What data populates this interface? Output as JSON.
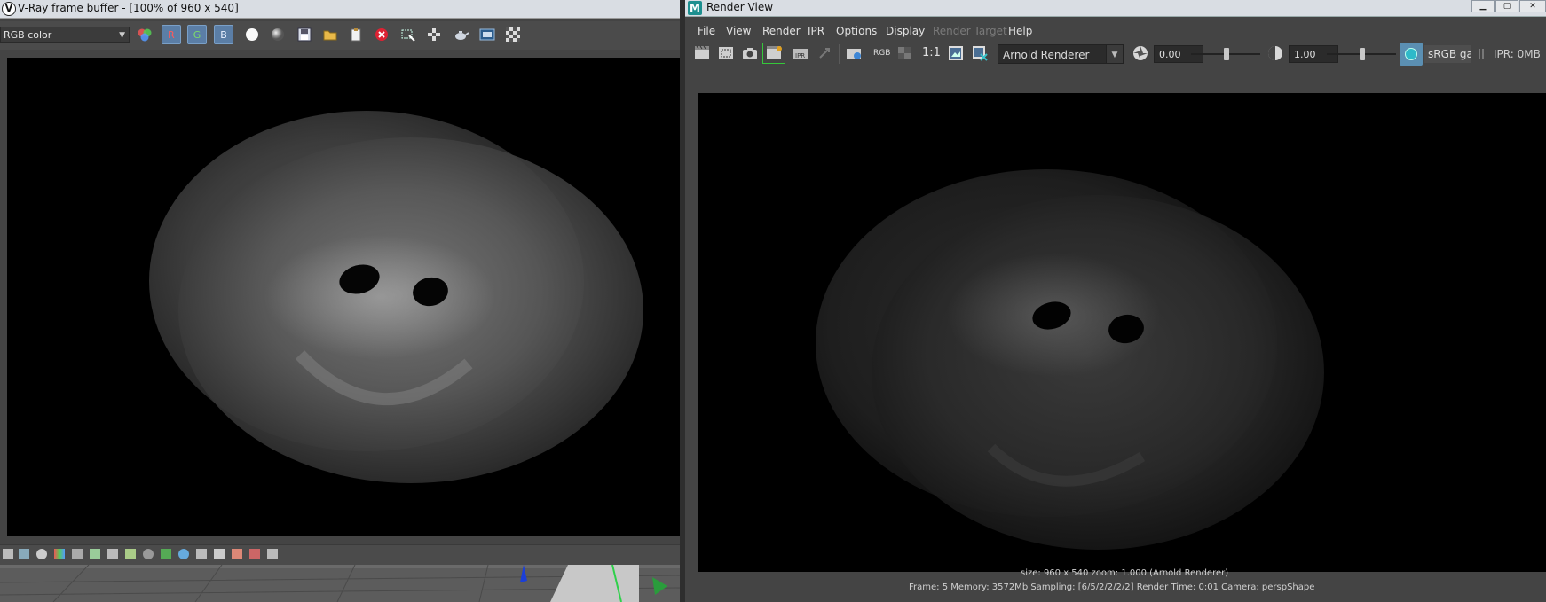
{
  "vray": {
    "title": "V-Ray frame buffer - [100% of 960 x 540]",
    "logo_letter": "V",
    "channel_select": "RGB color",
    "channel_buttons": [
      "R",
      "G",
      "B"
    ],
    "icons": [
      "color-channels-icon",
      "white-circle-icon",
      "grey-circle-icon",
      "save-icon",
      "open-folder-icon",
      "clipboard-icon",
      "clear-image-icon",
      "region-render-icon",
      "track-mouse-icon",
      "teapot-render-icon",
      "history-icon",
      "checker-icon"
    ]
  },
  "rv": {
    "title": "Render View",
    "logo_letter": "M",
    "menus": [
      "File",
      "View",
      "Render",
      "IPR",
      "Options",
      "Display",
      "Render Target",
      "Help"
    ],
    "ratio_label": "1:1",
    "rgb_label": "RGB",
    "renderer_select": "Arnold Renderer",
    "exposure": "0.00",
    "gamma_value": "1.00",
    "color_space": "sRGB gam",
    "ipr_memory": "IPR: 0MB",
    "info_line1": "size: 960 x 540  zoom: 1.000      (Arnold Renderer)",
    "info_line2": "Frame: 5     Memory: 3572Mb     Sampling: [6/5/2/2/2/2]     Render Time: 0:01     Camera: perspShape"
  }
}
